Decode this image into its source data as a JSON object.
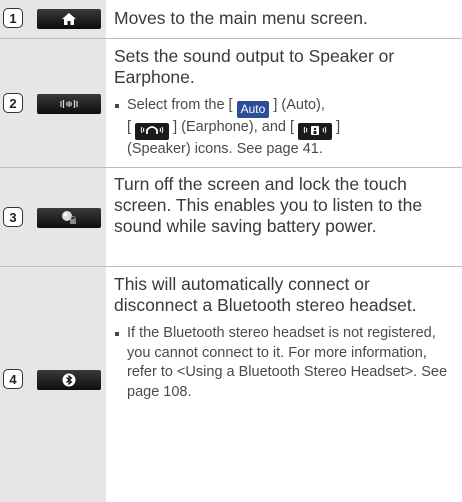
{
  "rows": [
    {
      "num": "1",
      "icon": "home-icon",
      "text": "Moves to the main menu screen."
    },
    {
      "num": "2",
      "icon": "sound-output-icon",
      "text": "Sets the sound output to Speaker or Earphone.",
      "bullet": {
        "part1": "Select from the [",
        "auto_icon": "Auto",
        "part2": "] (Auto),",
        "part3": "[",
        "part4": "] (Earphone), and [",
        "part5": "]",
        "part6": "(Speaker) icons. See page 41."
      }
    },
    {
      "num": "3",
      "icon": "screen-lock-icon",
      "text": "Turn off the screen and lock the touch screen. This enables you to listen to the sound while saving battery power."
    },
    {
      "num": "4",
      "icon": "bluetooth-icon",
      "text": "This will automatically connect or disconnect a Bluetooth stereo headset.",
      "bullet": "If the Bluetooth stereo headset is not registered, you cannot connect to it. For more information, refer to <Using a Bluetooth Stereo Headset>. See page 108."
    }
  ]
}
